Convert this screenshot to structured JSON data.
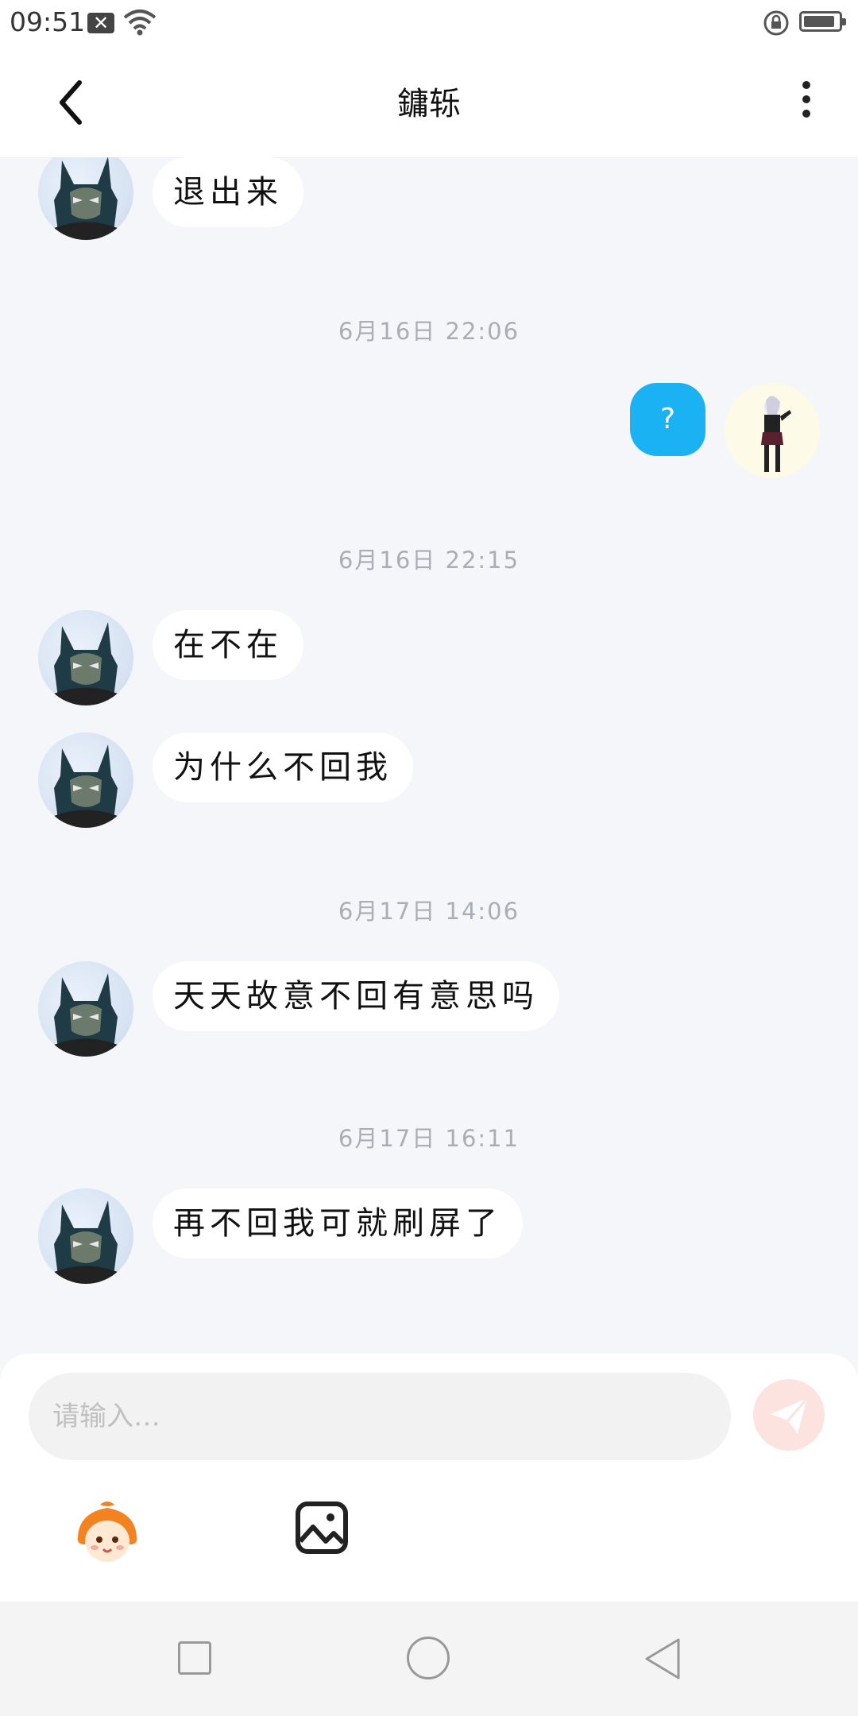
{
  "status_bar": {
    "time": "09:51"
  },
  "header": {
    "title": "鏞轹"
  },
  "messages": [
    {
      "type": "in",
      "text": "退出来"
    },
    {
      "type": "time",
      "text": "6月16日 22:06"
    },
    {
      "type": "out",
      "text": "?"
    },
    {
      "type": "time",
      "text": "6月16日 22:15"
    },
    {
      "type": "in",
      "text": "在不在"
    },
    {
      "type": "in",
      "text": "为什么不回我"
    },
    {
      "type": "time",
      "text": "6月17日 14:06"
    },
    {
      "type": "in",
      "text": "天天故意不回有意思吗"
    },
    {
      "type": "time",
      "text": "6月17日 16:11"
    },
    {
      "type": "in",
      "text": "再不回我可就刷屏了"
    }
  ],
  "composer": {
    "placeholder": "请输入…"
  },
  "colors": {
    "outgoing_bubble": "#1ab2f3",
    "send_button": "#fde3e0",
    "background": "#f4f6f9"
  },
  "icons": {
    "back": "chevron-left-icon",
    "more": "more-vertical-icon",
    "send": "paper-plane-icon",
    "emoji": "mascot-emoji-icon",
    "image": "image-icon"
  }
}
